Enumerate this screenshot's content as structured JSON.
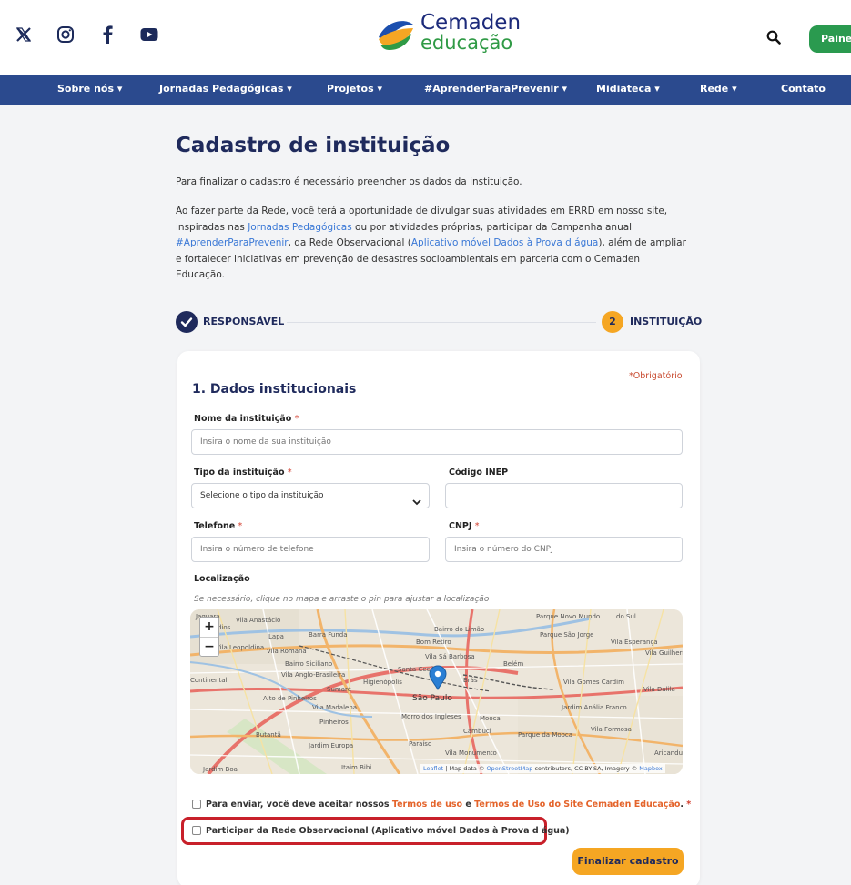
{
  "header": {
    "logo_line1": "Cemaden",
    "logo_line2": "educação",
    "painel_label": "Painel",
    "social_icons": [
      "x-icon",
      "instagram-icon",
      "facebook-icon",
      "youtube-icon"
    ]
  },
  "nav": {
    "items": [
      {
        "label": "Sobre nós ▾"
      },
      {
        "label": "Jornadas Pedagógicas ▾"
      },
      {
        "label": "Projetos ▾"
      },
      {
        "label": "#AprenderParaPrevenir ▾"
      },
      {
        "label": "Midiateca ▾"
      },
      {
        "label": "Rede ▾"
      },
      {
        "label": "Contato"
      }
    ]
  },
  "page": {
    "title": "Cadastro de instituição",
    "intro1": "Para finalizar o cadastro é necessário preencher os dados da instituição.",
    "intro2": {
      "a": "Ao fazer parte da Rede, você terá a oportunidade de divulgar suas atividades em ERRD em nosso site, inspiradas nas ",
      "link1": "Jornadas Pedagógicas",
      "b": " ou por atividades próprias, participar da Campanha anual ",
      "link2": "#AprenderParaPrevenir",
      "c": ", da Rede Observacional (",
      "link3": "Aplicativo móvel Dados à Prova d água",
      "d": "), além de ampliar e fortalecer iniciativas em prevenção de desastres socioambientais em parceria com o Cemaden Educação."
    }
  },
  "stepper": {
    "step1_label": "RESPONSÁVEL",
    "step2_number": "2",
    "step2_label": "INSTITUIÇÃO"
  },
  "form": {
    "required_note": "*Obrigatório",
    "section_title": "1. Dados institucionais",
    "required_mark": "*",
    "nome_label": "Nome da instituição",
    "nome_placeholder": "Insira o nome da sua instituição",
    "tipo_label": "Tipo da instituição",
    "tipo_selected": "Selecione o tipo da instituição",
    "inep_label": "Código INEP",
    "inep_value": "",
    "telefone_label": "Telefone",
    "telefone_placeholder": "Insira o número de telefone",
    "cnpj_label": "CNPJ",
    "cnpj_placeholder": "Insira o número do CNPJ",
    "localizacao_label": "Localização",
    "localizacao_hint": "Se necessário, clique no mapa e arraste o pin para ajustar a localização",
    "terms": {
      "a": "Para enviar, você deve aceitar nossos ",
      "link1": "Termos de uso",
      "b": " e ",
      "link2": "Termos de Uso do Site Cemaden Educação",
      "c": ". ",
      "req": "*"
    },
    "observacional_label": "Participar da Rede Observacional (Aplicativo móvel Dados à Prova d água)",
    "submit_label": "Finalizar cadastro"
  },
  "map": {
    "zoom_in": "+",
    "zoom_out": "−",
    "attribution": {
      "leaflet": "Leaflet",
      "a": " | Map data © ",
      "osm": "OpenStreetMap",
      "b": " contributors, CC-BY-SA, Imagery © ",
      "mapbox": "Mapbox"
    },
    "place_labels": [
      "Jaguara",
      "Vila Anastácio",
      "Barra Funda",
      "Bairro do Limão",
      "Bom Retiro",
      "Parque Novo Mundo",
      "Parque São Jorge",
      "Vila Esperança",
      "Lapa",
      "Vila Leopoldina",
      "Vila Romana",
      "Bairro Siciliano",
      "Vila Anglo-Brasileira",
      "Santa Cecília",
      "Vila Sá Barbosa",
      "Belém",
      "São Paulo",
      "Sumaré",
      "Higienópolis",
      "Brás",
      "Vila Gomes Cardim",
      "Vila Dalila",
      "Alto de Pinheiros",
      "Vila Madalena",
      "Pinheiros",
      "Morro dos Ingleses",
      "Mooca",
      "Jardim Anália Franco",
      "Butantã",
      "Jardim Europa",
      "Paraíso",
      "Cambuci",
      "Parque da Mooca",
      "Vila Formosa",
      "Vila Monumento",
      "Jardim Boa",
      "Itaim Bibi",
      "Vila Guilherme",
      "Aricanduva",
      "do Sul",
      "Continental",
      "Remédios"
    ]
  }
}
